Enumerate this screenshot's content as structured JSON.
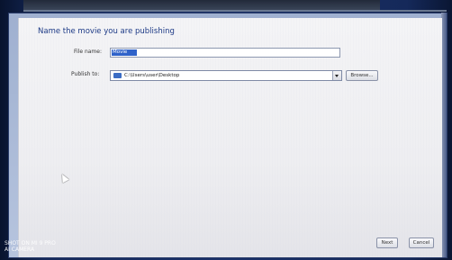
{
  "dialog": {
    "title": "Name the movie you are publishing",
    "file_name_label": "File name:",
    "file_name_value": "Movie",
    "publish_to_label": "Publish to:",
    "publish_to_path": "C:\\Users\\user\\Desktop",
    "browse_label": "Browse...",
    "next_label": "Next",
    "cancel_label": "Cancel"
  },
  "watermark": {
    "line1": "SHOT ON MI 9 PRO",
    "line2": "AI CAMERA"
  },
  "icons": {
    "folder": "folder-icon",
    "dropdown": "chevron-down-icon",
    "cursor": "mouse-pointer-icon"
  },
  "colors": {
    "title": "#1d3a86",
    "selection": "#2f62c9",
    "folder": "#3b6cc4"
  }
}
